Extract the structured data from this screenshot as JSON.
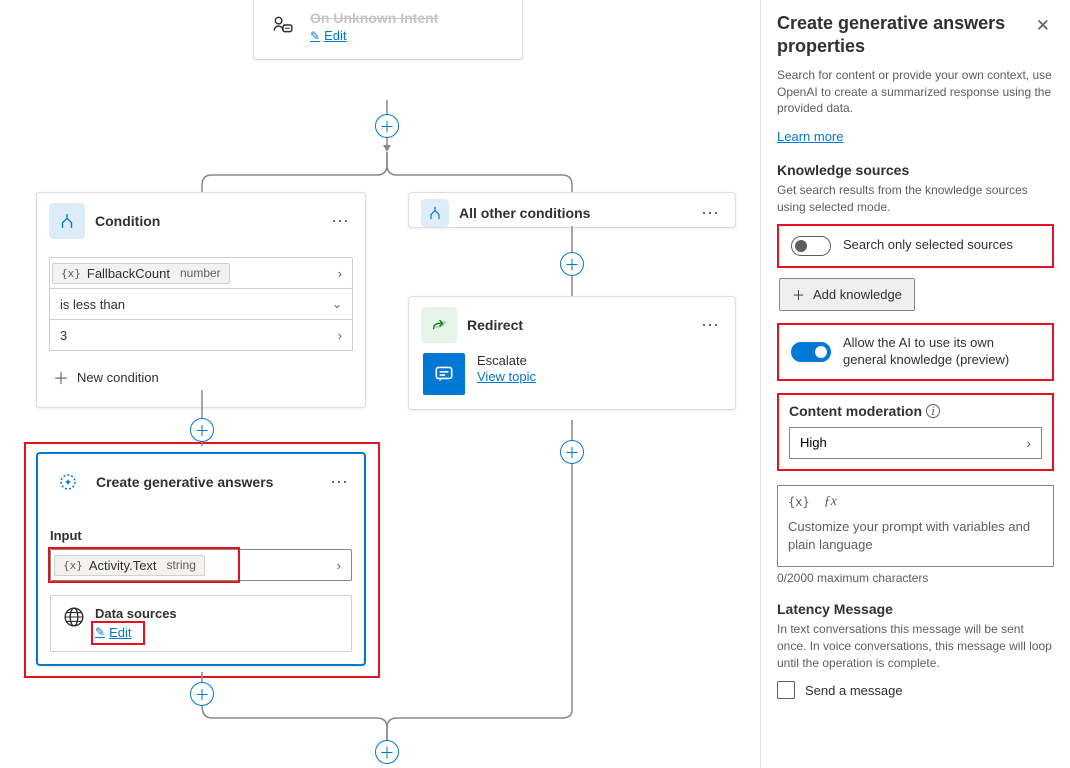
{
  "canvas": {
    "unknown_intent": {
      "title": "On Unknown Intent",
      "edit": "Edit"
    },
    "condition": {
      "title": "Condition",
      "variable": "FallbackCount",
      "var_type": "number",
      "operator": "is less than",
      "value": "3",
      "add_condition": "New condition"
    },
    "other_conditions": {
      "title": "All other conditions"
    },
    "redirect": {
      "title": "Redirect",
      "topic": "Escalate",
      "view_topic": "View topic"
    },
    "generative": {
      "title": "Create generative answers",
      "input_label": "Input",
      "input_var": "Activity.Text",
      "input_type": "string",
      "data_sources": "Data sources",
      "edit": "Edit"
    }
  },
  "panel": {
    "title": "Create generative answers properties",
    "description": "Search for content or provide your own context, use OpenAI to create a summarized response using the provided data.",
    "learn_more": "Learn more",
    "knowledge": {
      "title": "Knowledge sources",
      "desc": "Get search results from the knowledge sources using selected mode.",
      "toggle_selected": "Search only selected sources",
      "add_button": "Add knowledge",
      "toggle_general": "Allow the AI to use its own general knowledge (preview)"
    },
    "moderation": {
      "title": "Content moderation",
      "value": "High"
    },
    "fx": {
      "placeholder": "Customize your prompt with variables and plain language",
      "chars": "0/2000 maximum characters"
    },
    "latency": {
      "title": "Latency Message",
      "desc": "In text conversations this message will be sent once. In voice conversations, this message will loop until the operation is complete.",
      "checkbox": "Send a message"
    }
  }
}
